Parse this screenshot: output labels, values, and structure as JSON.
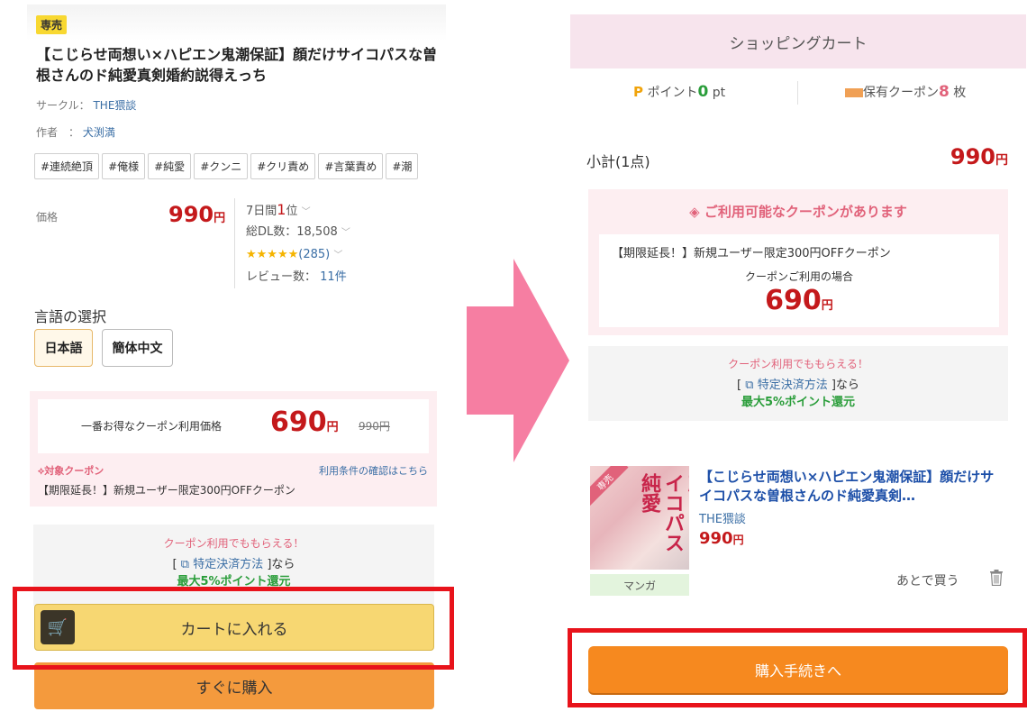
{
  "colors": {
    "price_red": "#c4191b",
    "accent_pink": "#e1627a",
    "cart_yellow": "#f7d772",
    "buy_orange": "#f49a3d",
    "checkout_orange": "#f6891f",
    "highlight_red": "#e8131b",
    "arrow_pink": "#f67ea2"
  },
  "product": {
    "badge": "専売",
    "title": "【こじらせ両想い×ハピエン鬼潮保証】顔だけサイコパスな曽根さんのド純愛真剣婚約説得えっち",
    "circle_label": "サークル：",
    "circle_value": "THE猥談",
    "author_label": "作者　：",
    "author_value": "犬渕満",
    "tags": [
      "#連続絶頂",
      "#俺様",
      "#純愛",
      "#クンニ",
      "#クリ責め",
      "#言葉責め",
      "#潮"
    ],
    "price_label": "価格",
    "price_value": "990",
    "price_unit": "円",
    "rank_prefix": "7日間",
    "rank_num": "1",
    "rank_suffix": "位",
    "downloads": "総DL数：18,508",
    "stars": "★★★★★",
    "rating_count": "(285)",
    "review_label": "レビュー数：",
    "review_count": "11件"
  },
  "language": {
    "label": "言語の選択",
    "options": [
      "日本語",
      "簡体中文"
    ],
    "selected": "日本語"
  },
  "best_coupon": {
    "label": "一番お得なクーポン利用価格",
    "price": "690",
    "unit": "円",
    "original": "990円",
    "target_label": "対象クーポン",
    "conditions_link": "利用条件の確認はこちら",
    "coupon_name": "【期限延長！】新規ユーザー限定300円OFFクーポン"
  },
  "point_promo": {
    "line1": "クーポン利用でももらえる！",
    "bracket_open": "[",
    "link": "特定決済方法",
    "bracket_close": "]なら",
    "line3": "最大5%ポイント還元"
  },
  "buttons": {
    "add_to_cart": "カートに入れる",
    "buy_now": "すぐに購入",
    "checkout": "購入手続きへ",
    "later": "あとで買う"
  },
  "cart": {
    "header": "ショッピングカート",
    "points_label": "ポイント",
    "points_value": "0",
    "points_unit": "pt",
    "coupons_label": "保有クーポン",
    "coupons_value": "8",
    "coupons_unit": "枚",
    "subtotal_label": "小計(1点)",
    "subtotal_value": "990",
    "subtotal_unit": "円",
    "available_title": "ご利用可能なクーポンがあります",
    "available_coupon": "【期限延長！】新規ユーザー限定300円OFFクーポン",
    "available_case": "クーポンご利用の場合",
    "available_price": "690",
    "available_unit": "円",
    "item_title": "【こじらせ両想い×ハピエン鬼潮保証】顔だけサイコパスな曽根さんのド純愛真剣…",
    "item_circle": "THE猥談",
    "item_price": "990",
    "item_unit": "円",
    "item_category": "マンガ",
    "thumb_badge": "専売",
    "thumb_text": "顔だけサイコパス純愛"
  }
}
